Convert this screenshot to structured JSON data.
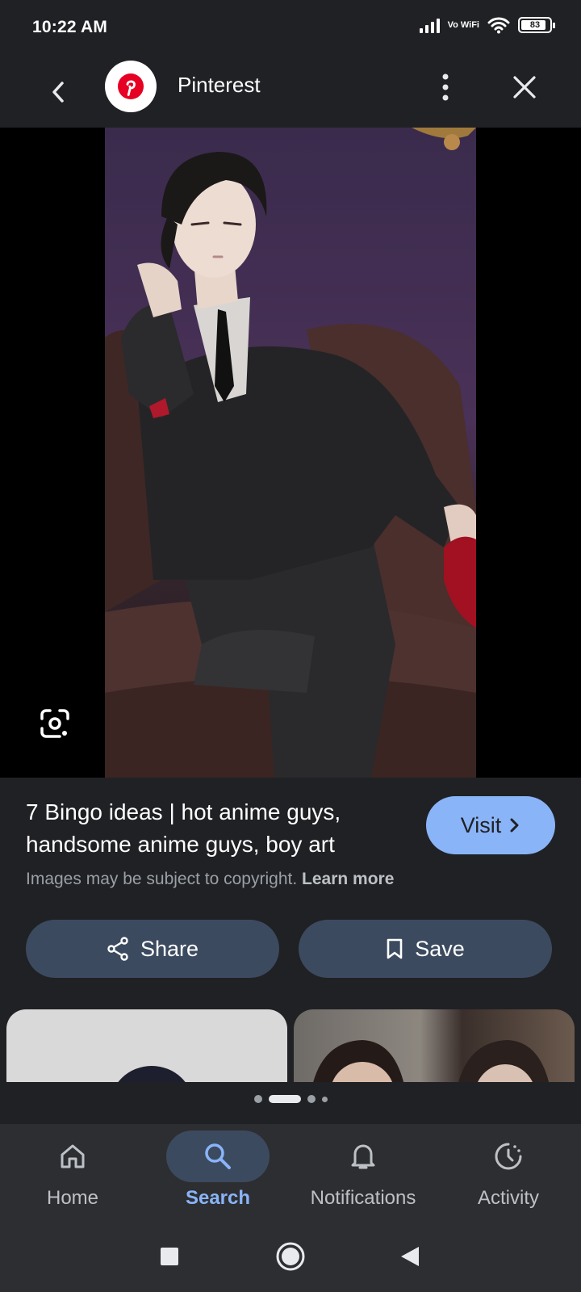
{
  "status_bar": {
    "time": "10:22 AM",
    "network": "Vo WiFi",
    "battery": "83"
  },
  "header": {
    "title": "Pinterest",
    "logo_icon": "pinterest-logo-icon",
    "back_icon": "chevron-left-icon",
    "more_icon": "more-vertical-icon",
    "close_icon": "close-icon"
  },
  "image": {
    "lens_icon": "google-lens-icon"
  },
  "result": {
    "title": "7 Bingo ideas | hot anime guys, handsome anime guys, boy art",
    "visit_label": "Visit",
    "copyright_text": "Images may be subject to copyright.",
    "learn_more": "Learn more",
    "share_label": "Share",
    "save_label": "Save"
  },
  "bottom_nav": {
    "items": [
      {
        "label": "Home",
        "icon": "home-icon",
        "active": false
      },
      {
        "label": "Search",
        "icon": "search-icon",
        "active": true
      },
      {
        "label": "Notifications",
        "icon": "bell-icon",
        "active": false
      },
      {
        "label": "Activity",
        "icon": "activity-icon",
        "active": false
      }
    ]
  },
  "colors": {
    "accent": "#8ab4f8",
    "background": "#202124",
    "button_bg": "#3c4a5f",
    "pinterest_red": "#e60023"
  }
}
